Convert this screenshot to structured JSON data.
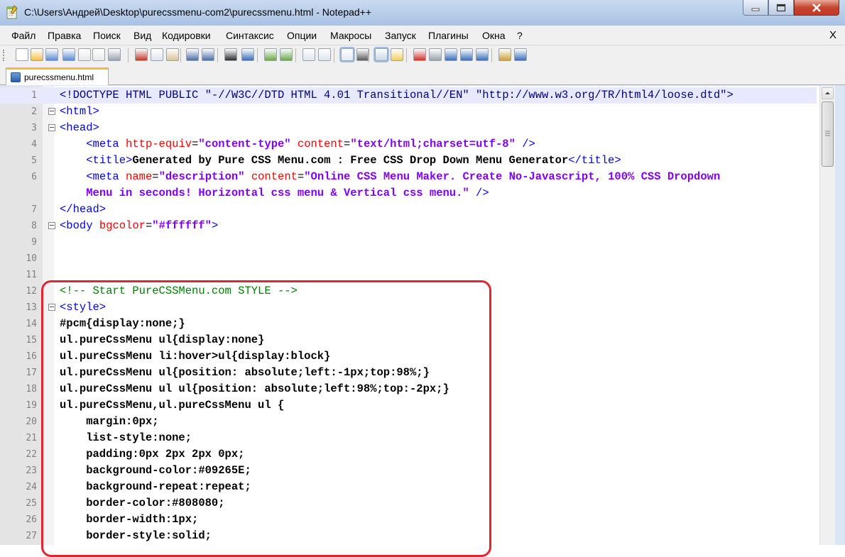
{
  "window": {
    "title": "C:\\Users\\Андрей\\Desktop\\purecssmenu-com2\\purecssmenu.html - Notepad++",
    "controls": [
      "minimize",
      "maximize",
      "close"
    ]
  },
  "menu": {
    "items": [
      "Файл",
      "Правка",
      "Поиск",
      "Вид",
      "Кодировки",
      "Синтаксис",
      "Опции",
      "Макросы",
      "Запуск",
      "Плагины",
      "Окна",
      "?"
    ],
    "close_label": "X"
  },
  "toolbar": {
    "icons": [
      "new-file-icon",
      "open-file-icon",
      "save-icon",
      "save-all-icon",
      "close-icon",
      "close-all-icon",
      "print-icon",
      "cut-icon",
      "copy-icon",
      "paste-icon",
      "undo-icon",
      "redo-icon",
      "find-icon",
      "replace-icon",
      "zoom-in-icon",
      "zoom-out-icon",
      "sync-vertical-icon",
      "sync-horizontal-icon",
      "word-wrap-icon",
      "show-all-chars-icon",
      "indent-guide-icon",
      "user-language-icon",
      "record-macro-icon",
      "stop-macro-icon",
      "play-macro-icon",
      "run-macro-multiple-icon",
      "save-macro-icon",
      "doc-map-icon",
      "spell-check-icon"
    ]
  },
  "tabs": [
    {
      "label": "purecssmenu.html",
      "active": true
    }
  ],
  "editor": {
    "current_line": 1,
    "lines": [
      {
        "n": "1",
        "fold": false,
        "html": "<span class=\"dt\">&lt;!DOCTYPE HTML PUBLIC \"-//W3C//DTD HTML 4.01 Transitional//EN\" \"http://www.w3.org/TR/html4/loose.dtd\"&gt;</span>"
      },
      {
        "n": "2",
        "fold": true,
        "html": "<span class=\"t\">&lt;html&gt;</span>"
      },
      {
        "n": "3",
        "fold": true,
        "html": "<span class=\"t\">&lt;head&gt;</span>"
      },
      {
        "n": "4",
        "fold": false,
        "html": "    <span class=\"t\">&lt;meta</span> <span class=\"a\">http-equiv</span><span class=\"plain\">=</span><span class=\"v\">\"content-type\"</span> <span class=\"a\">content</span><span class=\"plain\">=</span><span class=\"v\">\"text/html;charset=utf-8\"</span> <span class=\"t\">/&gt;</span>"
      },
      {
        "n": "5",
        "fold": false,
        "html": "    <span class=\"t\">&lt;title&gt;</span><span class=\"bold\">Generated by Pure CSS Menu.com : Free CSS Drop Down Menu Generator</span><span class=\"t\">&lt;/title&gt;</span>"
      },
      {
        "n": "6",
        "fold": false,
        "html": "    <span class=\"t\">&lt;meta</span> <span class=\"a\">name</span><span class=\"plain\">=</span><span class=\"v\">\"description\"</span> <span class=\"a\">content</span><span class=\"plain\">=</span><span class=\"v\">\"Online CSS Menu Maker. Create No-Javascript, 100% CSS Dropdown</span>"
      },
      {
        "n": "",
        "fold": false,
        "html": "    <span class=\"v\">Menu in seconds! Horizontal css menu &amp; Vertical css menu.\"</span> <span class=\"t\">/&gt;</span>"
      },
      {
        "n": "7",
        "fold": false,
        "html": "<span class=\"t\">&lt;/head&gt;</span>"
      },
      {
        "n": "8",
        "fold": true,
        "html": "<span class=\"t\">&lt;body</span> <span class=\"a\">bgcolor</span><span class=\"plain\">=</span><span class=\"v\">\"#ffffff\"</span><span class=\"t\">&gt;</span>"
      },
      {
        "n": "9",
        "fold": false,
        "html": ""
      },
      {
        "n": "10",
        "fold": false,
        "html": ""
      },
      {
        "n": "11",
        "fold": false,
        "html": ""
      },
      {
        "n": "12",
        "fold": false,
        "html": "<span class=\"cm\">&lt;!-- Start PureCSSMenu.com STYLE --&gt;</span>"
      },
      {
        "n": "13",
        "fold": true,
        "html": "<span class=\"t\">&lt;style&gt;</span>"
      },
      {
        "n": "14",
        "fold": false,
        "html": "<span class=\"bold\">#pcm{display:none;}</span>"
      },
      {
        "n": "15",
        "fold": false,
        "html": "<span class=\"bold\">ul.pureCssMenu ul{display:none}</span>"
      },
      {
        "n": "16",
        "fold": false,
        "html": "<span class=\"bold\">ul.pureCssMenu li:hover&gt;ul{display:block}</span>"
      },
      {
        "n": "17",
        "fold": false,
        "html": "<span class=\"bold\">ul.pureCssMenu ul{position: absolute;left:-1px;top:98%;}</span>"
      },
      {
        "n": "18",
        "fold": false,
        "html": "<span class=\"bold\">ul.pureCssMenu ul ul{position: absolute;left:98%;top:-2px;}</span>"
      },
      {
        "n": "19",
        "fold": false,
        "html": "<span class=\"bold\">ul.pureCssMenu,ul.pureCssMenu ul {</span>"
      },
      {
        "n": "20",
        "fold": false,
        "html": "<span class=\"bold\">    margin:0px;</span>"
      },
      {
        "n": "21",
        "fold": false,
        "html": "<span class=\"bold\">    list-style:none;</span>"
      },
      {
        "n": "22",
        "fold": false,
        "html": "<span class=\"bold\">    padding:0px 2px 2px 0px;</span>"
      },
      {
        "n": "23",
        "fold": false,
        "html": "<span class=\"bold\">    background-color:#09265E;</span>"
      },
      {
        "n": "24",
        "fold": false,
        "html": "<span class=\"bold\">    background-repeat:repeat;</span>"
      },
      {
        "n": "25",
        "fold": false,
        "html": "<span class=\"bold\">    border-color:#808080;</span>"
      },
      {
        "n": "26",
        "fold": false,
        "html": "<span class=\"bold\">    border-width:1px;</span>"
      },
      {
        "n": "27",
        "fold": false,
        "html": "<span class=\"bold\">    border-style:solid;</span>"
      }
    ]
  },
  "annotation": {
    "color": "#e02630"
  }
}
